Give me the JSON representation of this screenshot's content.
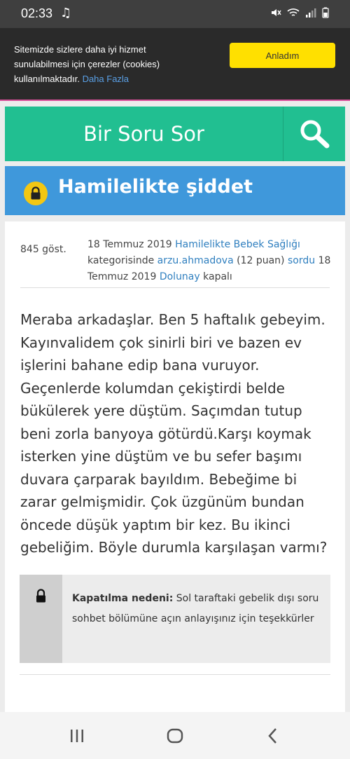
{
  "status_bar": {
    "time": "02:33",
    "icons": [
      "music-note-icon",
      "mute-icon",
      "wifi-icon",
      "signal-icon",
      "battery-icon"
    ]
  },
  "cookie": {
    "text": "Sitemizde sizlere daha iyi hizmet sunulabilmesi için çerezler (cookies) kullanılmaktadır.",
    "link": "Daha Fazla",
    "accept": "Anladım"
  },
  "header": {
    "ask_title": "Bir Soru Sor",
    "search_icon": "search-icon"
  },
  "question": {
    "title": "Hamilelikte şiddet",
    "views": "845 göst.",
    "meta": {
      "date1": "18 Temmuz 2019",
      "category": "Hamilelikte Bebek Sağlığı",
      "category_suffix": "kategorisinde",
      "author": "arzu.ahmadova",
      "points": "(12 puan)",
      "asked": "sordu",
      "date2": "18 Temmuz 2019",
      "closer": "Dolunay",
      "closed": "kapalı"
    },
    "body": "Meraba arkadaşlar. Ben 5 haftalık gebeyim. Kayınvalidem çok sinirli biri ve bazen ev işlerini bahane edip bana vuruyor. Geçenlerde kolumdan çekiştirdi belde bükülerek yere düştüm. Saçımdan tutup beni zorla banyoya götürdü.Karşı koymak isterken yine düştüm ve bu sefer başımı duvara çarparak bayıldım. Bebeğime bi zarar gelmişmidir. Çok üzgünüm bundan öncede düşük yaptım bir kez. Bu ikinci gebeliğim. Böyle durumla karşılaşan varmı?",
    "closed_label": "Kapatılma nedeni:",
    "closed_reason": "Sol taraftaki gebelik dışı soru sohbet bölümüne açın anlayışınız için teşekkürler"
  },
  "colors": {
    "green": "#21bf91",
    "blue": "#3f98db",
    "yellow": "#ffe000",
    "lock": "#f3c713",
    "link": "#2f7fbf"
  }
}
